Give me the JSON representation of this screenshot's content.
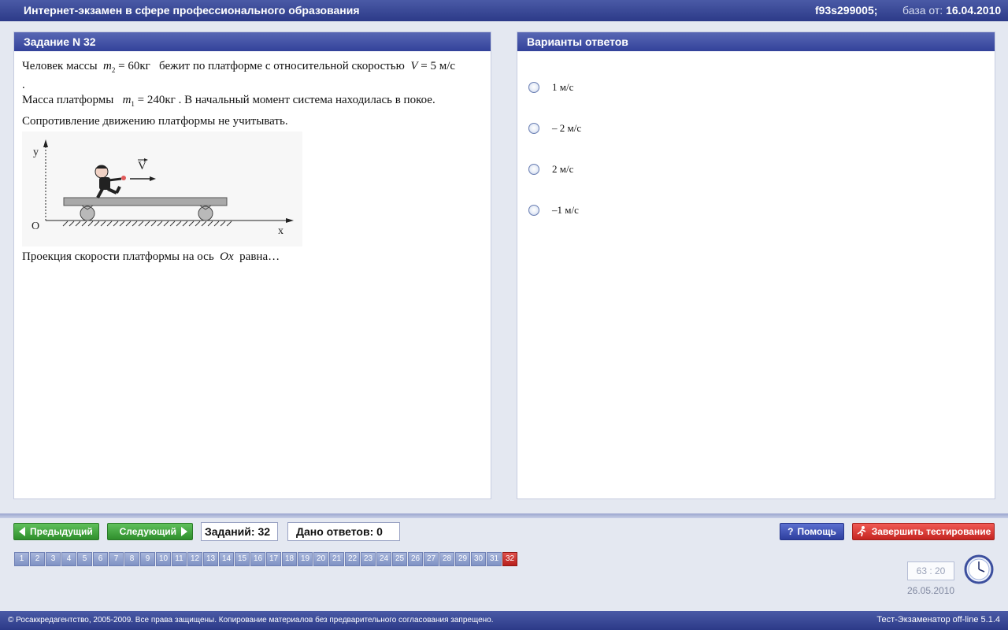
{
  "header": {
    "title": "Интернет-экзамен в сфере профессионального образования",
    "code": "f93s299005;",
    "base_prefix": "база от:",
    "base_date": "16.04.2010"
  },
  "task": {
    "heading": "Задание N 32",
    "line1_a": "Человек массы",
    "m2": "m",
    "m2_sub": "2",
    "m2_value": "= 60кг",
    "line1_b": "бежит по платформе с относительной скоростью",
    "v_sym": "V",
    "v_value": "= 5 м/с",
    "line1_end": ".",
    "line2_a": "Масса платформы",
    "m1": "m",
    "m1_sub": "1",
    "m1_value": "= 240кг",
    "line2_b": ". В начальный момент система находилась в покое.",
    "line3": "Сопротивление движению платформы не учитывать.",
    "question_a": "Проекция скорости платформы на ось",
    "axis": "Ox",
    "question_b": "равна…",
    "figure": {
      "y_label": "y",
      "x_label": "x",
      "origin": "O",
      "vector": "V"
    }
  },
  "answers": {
    "heading": "Варианты ответов",
    "options": [
      "1 м/с",
      "– 2 м/с",
      "2 м/с",
      "–1 м/с"
    ]
  },
  "controls": {
    "prev_label": "Предыдущий",
    "next_label": "Следующий",
    "tasks_count": "Заданий: 32",
    "answers_given": "Дано ответов: 0",
    "help_label": "Помощь",
    "finish_label": "Завершить тестирование"
  },
  "nav": {
    "numbers": [
      "1",
      "2",
      "3",
      "4",
      "5",
      "6",
      "7",
      "8",
      "9",
      "10",
      "11",
      "12",
      "13",
      "14",
      "15",
      "16",
      "17",
      "18",
      "19",
      "20",
      "21",
      "22",
      "23",
      "24",
      "25",
      "26",
      "27",
      "28",
      "29",
      "30",
      "31",
      "32"
    ],
    "current": "32"
  },
  "timer": {
    "value": "63 : 20",
    "date": "26.05.2010"
  },
  "footer": {
    "copyright": "© Росаккредагентство, 2005-2009. Все права защищены. Копирование материалов без предварительного согласования запрещено.",
    "version": "Тест-Экзаменатор off-line 5.1.4"
  }
}
